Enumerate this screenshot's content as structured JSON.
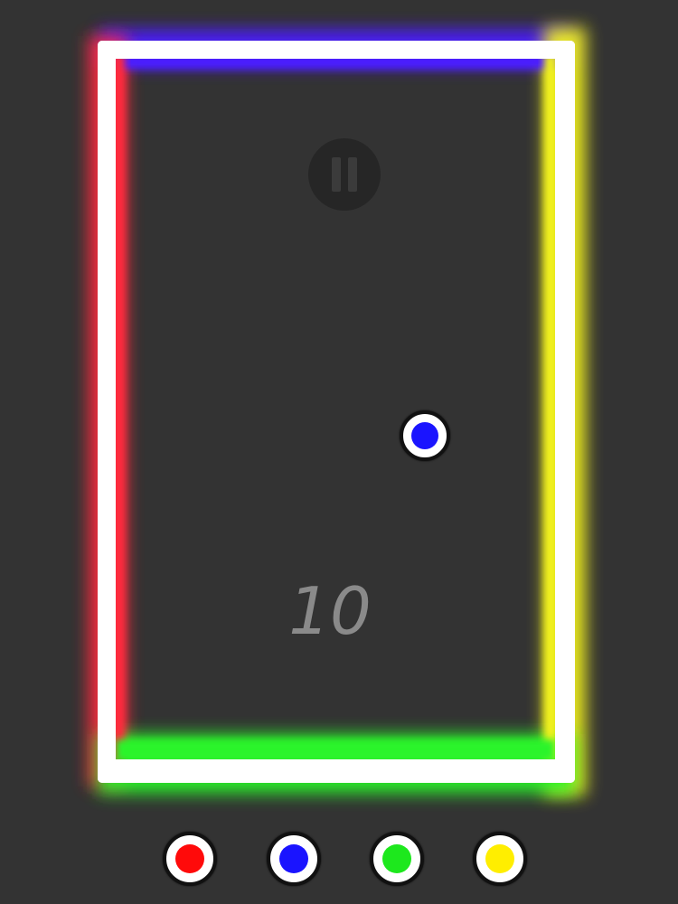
{
  "game": {
    "score": "10",
    "pause_icon": "pause-icon",
    "wall_colors": {
      "top": "#4b1bff",
      "left": "#ff2a3c",
      "right": "#f2f21a",
      "bottom": "#2cf42c"
    },
    "player_ball": {
      "color": "blue",
      "hex": "#1a14ff"
    },
    "color_buttons": [
      {
        "name": "red",
        "hex": "#ff0a0a"
      },
      {
        "name": "blue",
        "hex": "#1a14ff"
      },
      {
        "name": "green",
        "hex": "#1de81d"
      },
      {
        "name": "yellow",
        "hex": "#ffee00"
      }
    ]
  }
}
